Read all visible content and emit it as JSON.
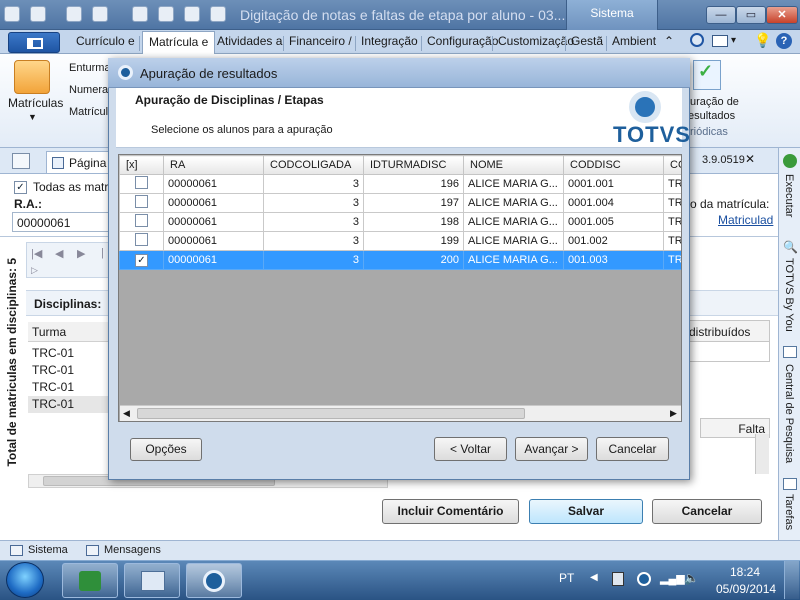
{
  "window": {
    "title": "Digitação de notas e faltas de etapa por aluno - 03.....",
    "system_label": "Sistema",
    "minimize": "—",
    "maximize": "▭",
    "close": "✕"
  },
  "ribbon": {
    "tabs": [
      "Currículo e",
      "Matrícula e",
      "Atividades a",
      "Financeiro /",
      "Integração",
      "Configuração",
      "Customização",
      "Gestã",
      "Ambient"
    ],
    "active_tab": "Matrícula e",
    "left_group": {
      "big_button": "Matrículas",
      "items": [
        "Enturma",
        "Numerac",
        "Matrícula"
      ]
    },
    "right_group": {
      "line1": "uração de",
      "line2": "esultados",
      "line3": "riódicas"
    }
  },
  "document": {
    "tab_label": "Página In",
    "version_text": "3.9.0519",
    "all_enrollments_label": "Todas as matrícu",
    "ra_label": "R.A.:",
    "ra_value": "00000061",
    "enrollment_suffix": "o da matrícula:",
    "enrollment_link": "Matriculad",
    "vertical_total": "Total de matriculas em disciplinas: 5",
    "disciplines_label": "Disciplinas:",
    "column_turma": "Turma",
    "turma_rows": [
      "TRC-01",
      "TRC-01",
      "TRC-01",
      "TRC-01"
    ],
    "distributed_header": "distribuídos",
    "faltas_header": "Falta",
    "buttons": {
      "include_comment": "Incluir Comentário",
      "save": "Salvar",
      "cancel": "Cancelar"
    }
  },
  "right_sidebar": [
    "Executar",
    "TOTVS By You",
    "Central de Pesquisa",
    "Tarefas"
  ],
  "statusbar": {
    "sistema": "Sistema",
    "mensagens": "Mensagens"
  },
  "dialog": {
    "title": "Apuração de resultados",
    "heading": "Apuração de Disciplinas / Etapas",
    "subtitle": "Selecione os alunos para a apuração",
    "logo_text": "TOTVS",
    "grid": {
      "columns": [
        "[x]",
        "RA",
        "CODCOLIGADA",
        "IDTURMADISC",
        "NOME",
        "CODDISC",
        "CO"
      ],
      "rows": [
        {
          "checked": false,
          "ra": "00000061",
          "codcoligada": "3",
          "idturmadisc": "196",
          "nome": "ALICE MARIA G...",
          "coddisc": "0001.001",
          "co": "TRC"
        },
        {
          "checked": false,
          "ra": "00000061",
          "codcoligada": "3",
          "idturmadisc": "197",
          "nome": "ALICE MARIA G...",
          "coddisc": "0001.004",
          "co": "TRC"
        },
        {
          "checked": false,
          "ra": "00000061",
          "codcoligada": "3",
          "idturmadisc": "198",
          "nome": "ALICE MARIA G...",
          "coddisc": "0001.005",
          "co": "TRC"
        },
        {
          "checked": false,
          "ra": "00000061",
          "codcoligada": "3",
          "idturmadisc": "199",
          "nome": "ALICE MARIA G...",
          "coddisc": "001.002",
          "co": "TRC"
        },
        {
          "checked": true,
          "ra": "00000061",
          "codcoligada": "3",
          "idturmadisc": "200",
          "nome": "ALICE MARIA G...",
          "coddisc": "001.003",
          "co": "TRC"
        }
      ]
    },
    "buttons": {
      "options": "Opções",
      "back": "< Voltar",
      "next": "Avançar >",
      "cancel": "Cancelar"
    }
  },
  "taskbar": {
    "language": "PT",
    "time": "18:24",
    "date": "05/09/2014"
  },
  "colors": {
    "selected_row": "#3399ff",
    "ribbon_blue": "#1f55a3",
    "totvs_blue": "#1e5f9c"
  }
}
